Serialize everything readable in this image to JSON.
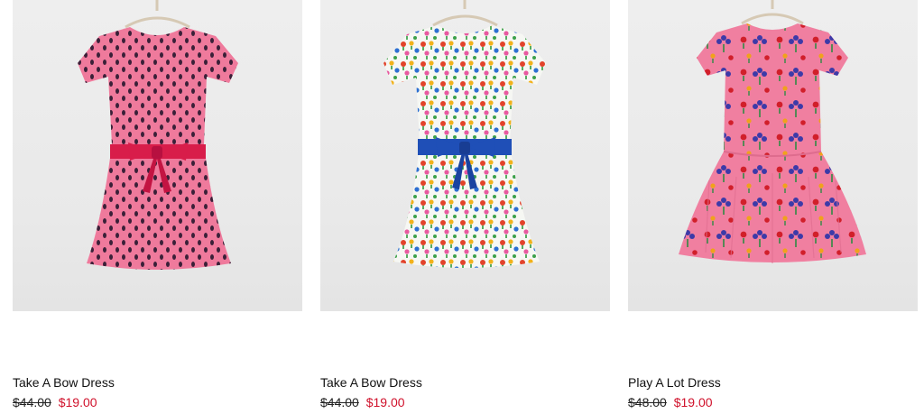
{
  "colors": {
    "sale_price": "#d0112b",
    "photo_background": "#ececec"
  },
  "products": [
    {
      "name": "Take A Bow Dress",
      "original_price": "$44.00",
      "sale_price": "$19.00",
      "dress_color": "#ef7a9c",
      "bow_color": "#d81d4a",
      "pattern": "navy-dots",
      "icon": "pink-dress-image"
    },
    {
      "name": "Take A Bow Dress",
      "original_price": "$44.00",
      "sale_price": "$19.00",
      "dress_color": "#f6f7f3",
      "bow_color": "#1f4fb7",
      "pattern": "multicolor-flowers",
      "icon": "floral-dress-image"
    },
    {
      "name": "Play A Lot Dress",
      "original_price": "$48.00",
      "sale_price": "$19.00",
      "dress_color": "#f07fa0",
      "bow_color": "",
      "pattern": "floral-sprigs",
      "icon": "pink-floral-dress-image"
    }
  ]
}
